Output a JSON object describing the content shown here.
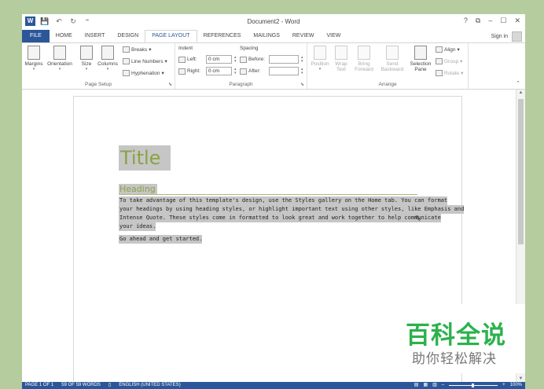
{
  "window": {
    "title": "Document2 - Word",
    "controls": [
      "?",
      "⧉",
      "–",
      "☐",
      "✕"
    ],
    "app_icon": "W"
  },
  "qat": {
    "save": "💾",
    "undo": "↶",
    "redo": "↻",
    "customize": "⁼"
  },
  "tabs": [
    {
      "label": "FILE"
    },
    {
      "label": "HOME"
    },
    {
      "label": "INSERT"
    },
    {
      "label": "DESIGN"
    },
    {
      "label": "PAGE LAYOUT"
    },
    {
      "label": "REFERENCES"
    },
    {
      "label": "MAILINGS"
    },
    {
      "label": "REVIEW"
    },
    {
      "label": "VIEW"
    }
  ],
  "signin": "Sign in",
  "ribbon": {
    "page_setup": {
      "label": "Page Setup",
      "margins": "Margins",
      "orientation": "Orientation",
      "size": "Size",
      "columns": "Columns",
      "breaks": "Breaks",
      "line_numbers": "Line Numbers",
      "hyphenation": "Hyphenation"
    },
    "paragraph": {
      "label": "Paragraph",
      "indent": "Indent",
      "spacing": "Spacing",
      "left": "Left:",
      "right": "Right:",
      "before": "Before:",
      "after": "After:",
      "left_value": "0 cm",
      "right_value": "0 cm",
      "before_value": "",
      "after_value": ""
    },
    "arrange": {
      "label": "Arrange",
      "position": "Position",
      "wrap_text": "Wrap Text",
      "bring_forward": "Bring Forward",
      "send_backward": "Send Backward",
      "selection_pane": "Selection Pane",
      "align": "Align",
      "group": "Group",
      "rotate": "Rotate"
    }
  },
  "document": {
    "title": "Title",
    "heading": "Heading",
    "body_lines": [
      "To take advantage of this template's design, use the Styles gallery on the Home tab. You can format",
      "your headings by using heading styles, or highlight important text using other styles, like Emphasis and",
      "Intense Quote. These styles come in formatted to look great and work together to help communicate",
      "your ideas."
    ],
    "closing": "Go ahead and get started."
  },
  "status": {
    "page": "PAGE 1 OF 1",
    "words": "59 OF 59 WORDS",
    "language": "ENGLISH (UNITED STATES)",
    "zoom": "100%",
    "zoom_minus": "–",
    "zoom_plus": "+"
  },
  "watermark": {
    "main": "百科全说",
    "sub": "助你轻松解决"
  },
  "colors": {
    "accent": "#2b579a",
    "heading": "#8aa342",
    "selection": "#c6c6c6",
    "background": "#b5cc9f",
    "watermark": "#2bb24c"
  }
}
